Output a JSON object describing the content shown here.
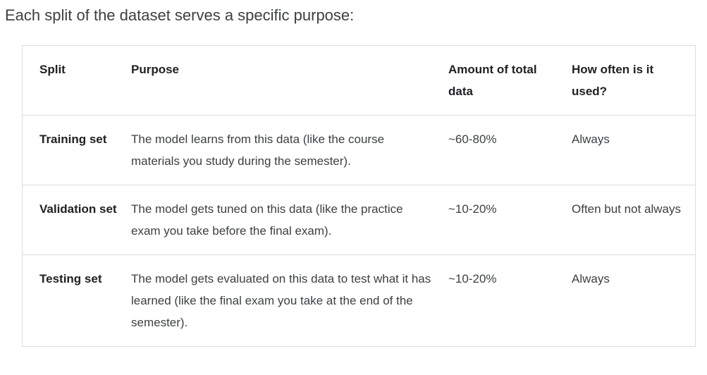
{
  "intro": "Each split of the dataset serves a specific purpose:",
  "table": {
    "headers": [
      "Split",
      "Purpose",
      "Amount of total data",
      "How often is it used?"
    ],
    "rows": [
      {
        "split": "Training set",
        "purpose": "The model learns from this data (like the course materials you study during the semester).",
        "amount": "~60-80%",
        "frequency": "Always"
      },
      {
        "split": "Validation set",
        "purpose": "The model gets tuned on this data (like the practice exam you take before the final exam).",
        "amount": "~10-20%",
        "frequency": "Often but not always"
      },
      {
        "split": "Testing set",
        "purpose": "The model gets evaluated on this data to test what it has learned (like the final exam you take at the end of the semester).",
        "amount": "~10-20%",
        "frequency": "Always"
      }
    ]
  }
}
